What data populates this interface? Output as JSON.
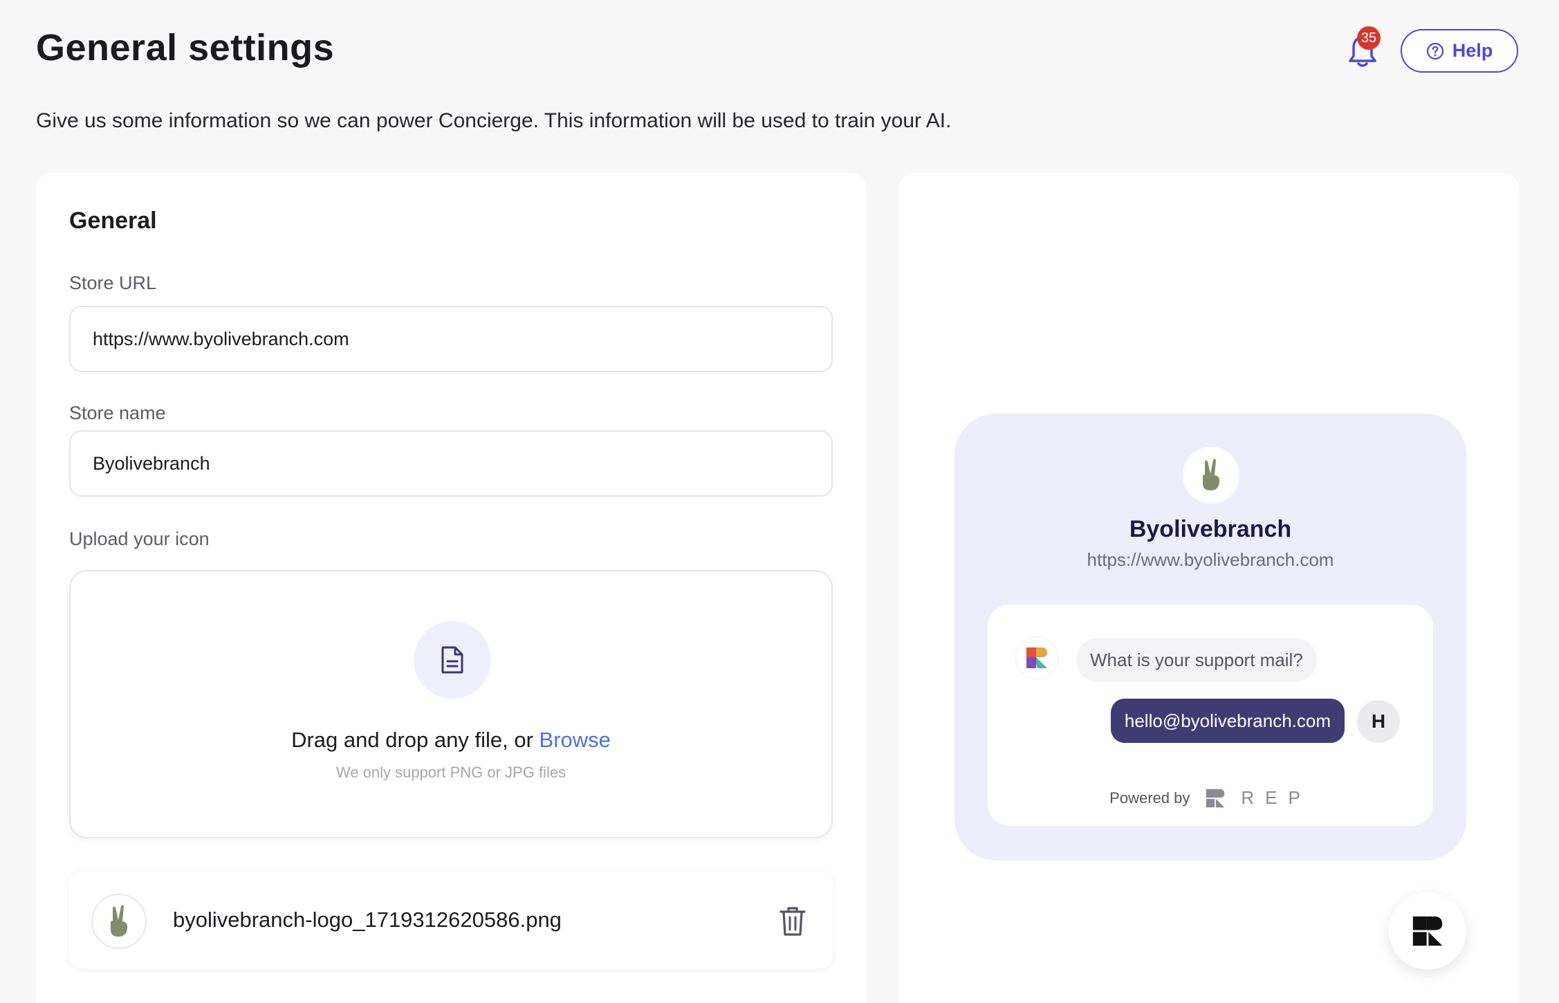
{
  "header": {
    "title": "General settings",
    "subtitle": "Give us some information so we can power Concierge. This information will be used to train your AI.",
    "notification_count": "35",
    "help_label": "Help"
  },
  "general": {
    "section_title": "General",
    "store_url_label": "Store URL",
    "store_url_value": "https://www.byolivebranch.com",
    "store_name_label": "Store name",
    "store_name_value": "Byolivebranch",
    "upload_label": "Upload your icon",
    "dropzone": {
      "text": "Drag and drop any file, or",
      "browse": "Browse",
      "hint": "We only support PNG or JPG files"
    },
    "uploaded_file": {
      "name": "byolivebranch-logo_1719312620586.png"
    }
  },
  "preview": {
    "store_name": "Byolivebranch",
    "store_url": "https://www.byolivebranch.com",
    "bot_message": "What is your support mail?",
    "user_message": "hello@byolivebranch.com",
    "user_initial": "H",
    "powered_by": "Powered by",
    "brand_word": "REP"
  },
  "colors": {
    "accent": "#4f46d8",
    "badge": "#d9352b",
    "preview_bg": "#eeedfc",
    "user_bubble": "#3f3c73"
  }
}
